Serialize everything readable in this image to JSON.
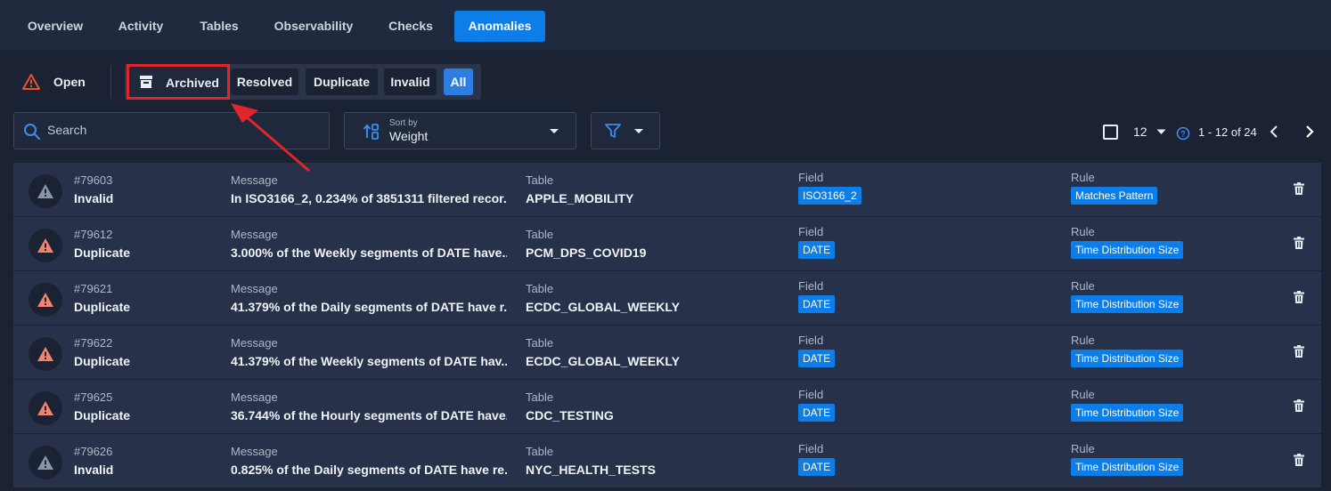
{
  "tabs": [
    {
      "label": "Overview",
      "active": false
    },
    {
      "label": "Activity",
      "active": false
    },
    {
      "label": "Tables",
      "active": false
    },
    {
      "label": "Observability",
      "active": false
    },
    {
      "label": "Checks",
      "active": false
    },
    {
      "label": "Anomalies",
      "active": true
    }
  ],
  "status": {
    "open_label": "Open",
    "archived_label": "Archived",
    "resolved_label": "Resolved",
    "duplicate_label": "Duplicate",
    "invalid_label": "Invalid",
    "all_label": "All"
  },
  "search": {
    "placeholder": "Search"
  },
  "sort": {
    "small_label": "Sort by",
    "value": "Weight"
  },
  "pagination": {
    "per_page": "12",
    "range": "1 - 12 of 24"
  },
  "labels": {
    "message": "Message",
    "table": "Table",
    "field": "Field",
    "rule": "Rule"
  },
  "colors": {
    "accent": "#0d7de8",
    "invalid_icon": "#8a95ab",
    "duplicate_icon": "#f0846c",
    "highlight": "#e2242b"
  },
  "rows": [
    {
      "id": "#79603",
      "status": "Invalid",
      "icon": "warning-icon-gray",
      "message": "In ISO3166_2, 0.234% of 3851311 filtered recor...",
      "table": "APPLE_MOBILITY",
      "field": "ISO3166_2",
      "rule": "Matches Pattern"
    },
    {
      "id": "#79612",
      "status": "Duplicate",
      "icon": "warning-icon-orange",
      "message": "3.000% of the Weekly segments of DATE have...",
      "table": "PCM_DPS_COVID19",
      "field": "DATE",
      "rule": "Time Distribution Size"
    },
    {
      "id": "#79621",
      "status": "Duplicate",
      "icon": "warning-icon-orange",
      "message": "41.379% of the Daily segments of DATE have r...",
      "table": "ECDC_GLOBAL_WEEKLY",
      "field": "DATE",
      "rule": "Time Distribution Size"
    },
    {
      "id": "#79622",
      "status": "Duplicate",
      "icon": "warning-icon-orange",
      "message": "41.379% of the Weekly segments of DATE hav...",
      "table": "ECDC_GLOBAL_WEEKLY",
      "field": "DATE",
      "rule": "Time Distribution Size"
    },
    {
      "id": "#79625",
      "status": "Duplicate",
      "icon": "warning-icon-orange",
      "message": "36.744% of the Hourly segments of DATE have...",
      "table": "CDC_TESTING",
      "field": "DATE",
      "rule": "Time Distribution Size"
    },
    {
      "id": "#79626",
      "status": "Invalid",
      "icon": "warning-icon-gray",
      "message": "0.825% of the Daily segments of DATE have re...",
      "table": "NYC_HEALTH_TESTS",
      "field": "DATE",
      "rule": "Time Distribution Size"
    }
  ]
}
